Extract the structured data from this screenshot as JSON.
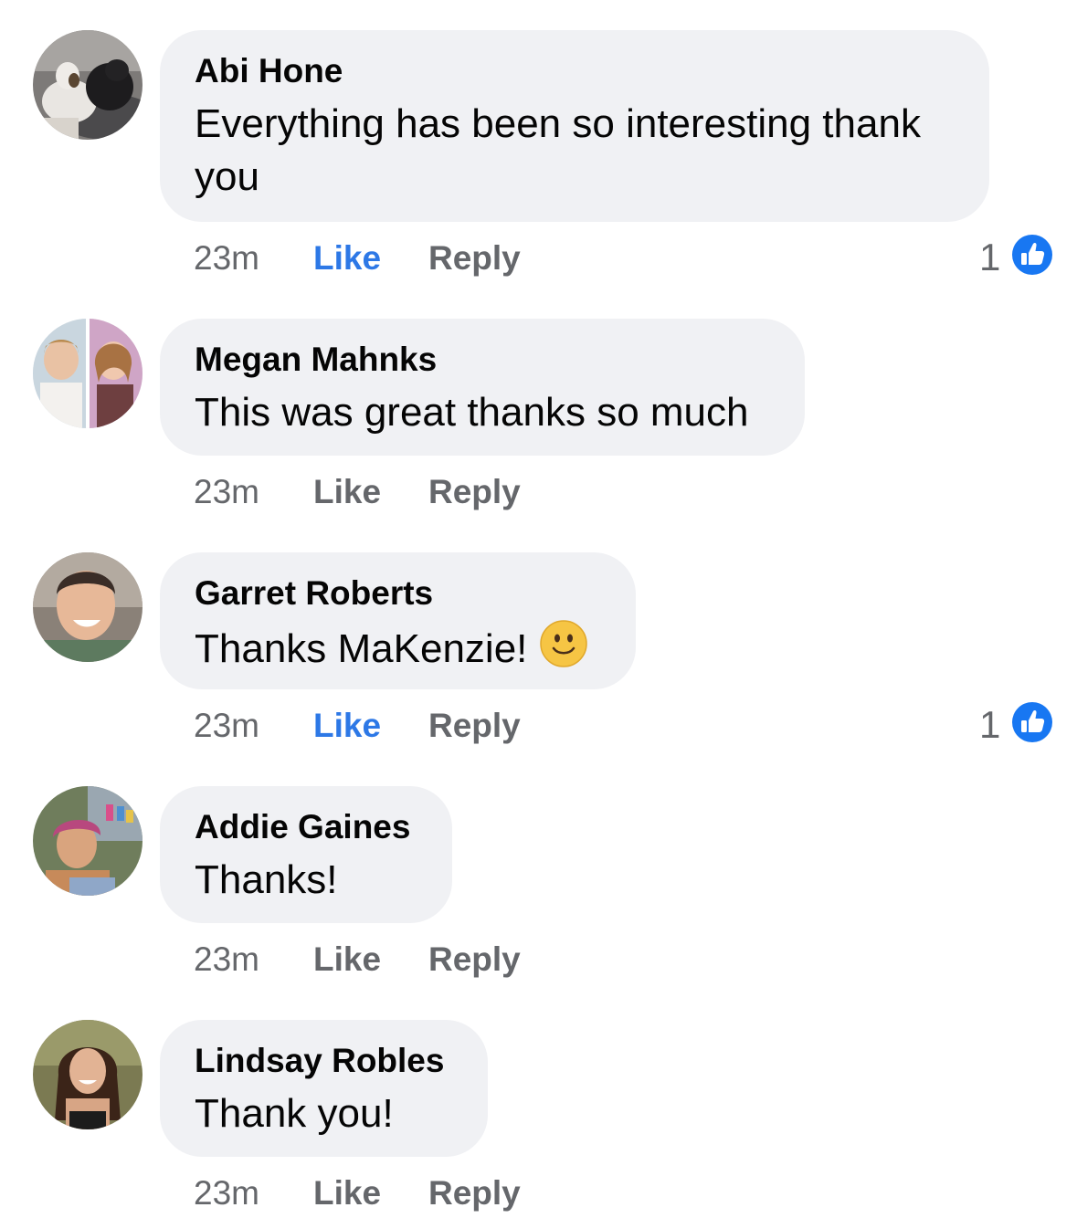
{
  "colors": {
    "bubble": "#f0f1f4",
    "meta_text": "#65676b",
    "liked_blue": "#2d78e6",
    "reaction_blue": "#1877f2"
  },
  "comments": [
    {
      "author": "Abi Hone",
      "text_line1": "Everything has been so interesting thank",
      "text_line2": "you",
      "time": "23m",
      "like": "Like",
      "reply": "Reply",
      "liked": true,
      "reaction_count": "1"
    },
    {
      "author": "Megan Mahnks",
      "text": "This was great thanks so much",
      "time": "23m",
      "like": "Like",
      "reply": "Reply",
      "liked": false
    },
    {
      "author": "Garret Roberts",
      "text": "Thanks MaKenzie!",
      "emoji": "slightly-smiling-face",
      "time": "23m",
      "like": "Like",
      "reply": "Reply",
      "liked": true,
      "reaction_count": "1"
    },
    {
      "author": "Addie Gaines",
      "text": "Thanks!",
      "time": "23m",
      "like": "Like",
      "reply": "Reply",
      "liked": false
    },
    {
      "author": "Lindsay Robles",
      "text": "Thank you!",
      "time": "23m",
      "like": "Like",
      "reply": "Reply",
      "liked": false
    }
  ]
}
